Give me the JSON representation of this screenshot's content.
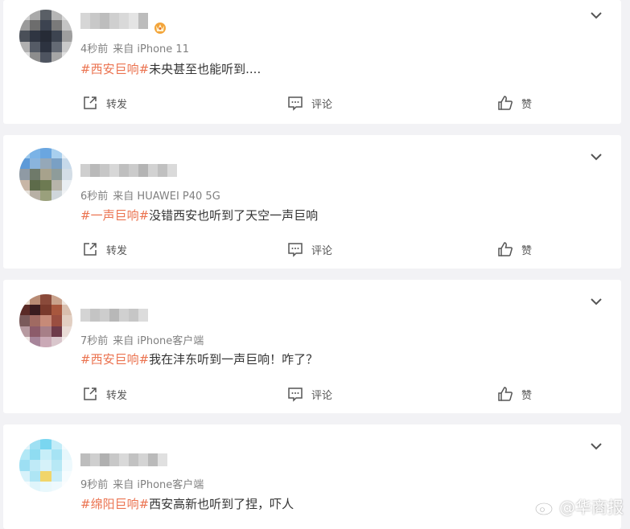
{
  "colors": {
    "hashtag": "#eb7350",
    "meta": "#808080",
    "text": "#333333",
    "background": "#f2f2f5"
  },
  "icons": {
    "repost": "share-arrow-icon",
    "comment": "comment-icon",
    "like": "thumb-up-icon",
    "menu": "chevron-down-icon",
    "vip": "crown-badge-icon"
  },
  "posts": [
    {
      "time": "4秒前",
      "source": "来自 iPhone 11",
      "hashtag": "#西安巨响#",
      "body": "未央甚至也能听到....",
      "actions": {
        "repost": "转发",
        "comment": "评论",
        "like": "赞"
      }
    },
    {
      "time": "6秒前",
      "source": "来自 HUAWEI P40 5G",
      "hashtag": "#一声巨响#",
      "body": "没错西安也听到了天空一声巨响",
      "actions": {
        "repost": "转发",
        "comment": "评论",
        "like": "赞"
      }
    },
    {
      "time": "7秒前",
      "source": "来自 iPhone客户端",
      "hashtag": "#西安巨响#",
      "body": "我在沣东听到一声巨响！咋了？",
      "actions": {
        "repost": "转发",
        "comment": "评论",
        "like": "赞"
      }
    },
    {
      "time": "9秒前",
      "source": "来自 iPhone客户端",
      "hashtag": "#绵阳巨响#",
      "body": "西安高新也听到了捏，吓人"
    }
  ],
  "watermark": {
    "text": "@华商报"
  }
}
